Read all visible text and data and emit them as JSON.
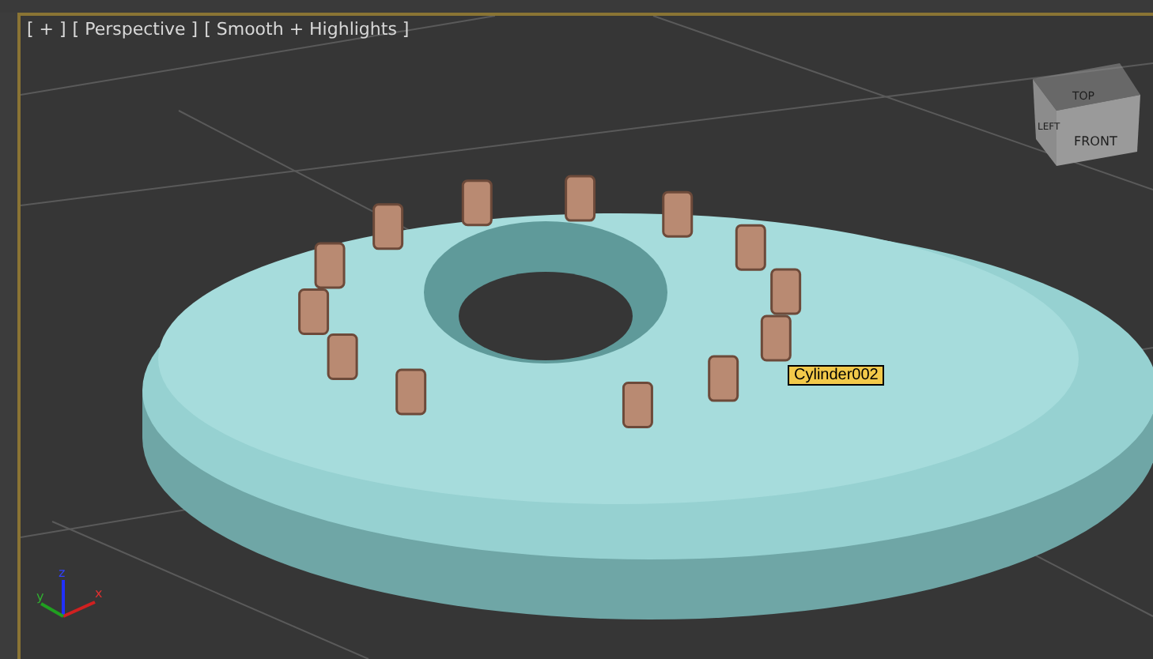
{
  "viewport": {
    "menus": [
      {
        "label": "[ + ]"
      },
      {
        "label": "[ Perspective ]"
      },
      {
        "label": "[ Smooth + Highlights ]"
      }
    ],
    "object_label": "Cylinder002",
    "axis_gizmo": {
      "x": "x",
      "y": "y",
      "z": "z"
    },
    "view_cube": {
      "top": "TOP",
      "left": "LEFT",
      "front": "FRONT"
    }
  }
}
